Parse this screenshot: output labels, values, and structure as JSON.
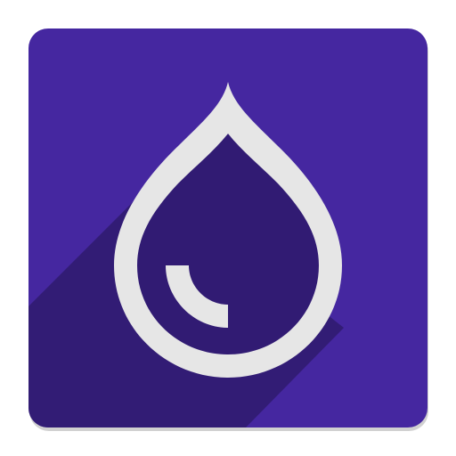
{
  "icon": {
    "name": "water-drop-app-icon",
    "glyph": "water-drop-icon",
    "colors": {
      "tile": "#4527A0",
      "tile_shadow": "#2E1A6E",
      "long_shadow": "#311B73",
      "drop_inner": "#311B73",
      "drop_outline": "#E6E6E6",
      "highlight": "#E6E6E6"
    }
  }
}
